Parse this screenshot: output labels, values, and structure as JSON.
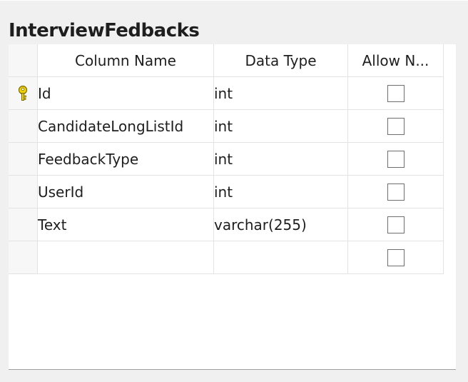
{
  "table": {
    "title": "InterviewFedbacks",
    "columns": [
      "Column Name",
      "Data Type",
      "Allow N..."
    ],
    "rows": [
      {
        "name": "Id",
        "type": "int",
        "allow_nulls": false,
        "primary_key": true
      },
      {
        "name": "CandidateLongListId",
        "type": "int",
        "allow_nulls": false,
        "primary_key": false
      },
      {
        "name": "FeedbackType",
        "type": "int",
        "allow_nulls": false,
        "primary_key": false
      },
      {
        "name": "UserId",
        "type": "int",
        "allow_nulls": false,
        "primary_key": false
      },
      {
        "name": "Text",
        "type": "varchar(255)",
        "allow_nulls": false,
        "primary_key": false
      },
      {
        "name": "",
        "type": "",
        "allow_nulls": false,
        "primary_key": false
      }
    ]
  },
  "colors": {
    "background": "#f0f0f0",
    "grid_line": "#e3e3e3",
    "key_icon": "#e8c400"
  },
  "icons": {
    "primary_key": "key-icon"
  }
}
